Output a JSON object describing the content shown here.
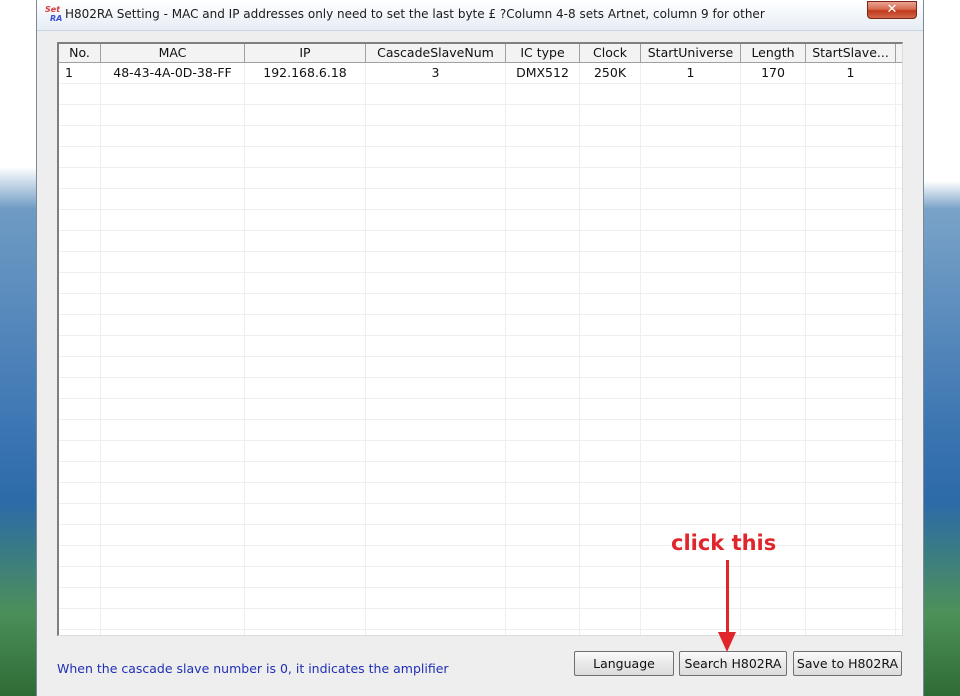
{
  "window": {
    "title": "H802RA Setting - MAC and IP addresses only need to set the last byte £ ?Column 4-8 sets Artnet, column 9 for other",
    "icon_text_top": "Set",
    "icon_text_bottom": "RA",
    "close_glyph": "✕"
  },
  "table": {
    "columns": [
      "No.",
      "MAC",
      "IP",
      "CascadeSlaveNum",
      "IC type",
      "Clock",
      "StartUniverse",
      "Length",
      "StartSlave..."
    ],
    "rows": [
      [
        "1",
        "48-43-4A-0D-38-FF",
        "192.168.6.18",
        "3",
        "DMX512",
        "250K",
        "1",
        "170",
        "1"
      ]
    ]
  },
  "status_text": "When the cascade slave number is 0, it indicates the amplifier",
  "buttons": {
    "language": "Language",
    "search": "Search H802RA",
    "save": "Save to H802RA"
  },
  "annotation": {
    "text": "click this",
    "color": "#e0252b"
  }
}
